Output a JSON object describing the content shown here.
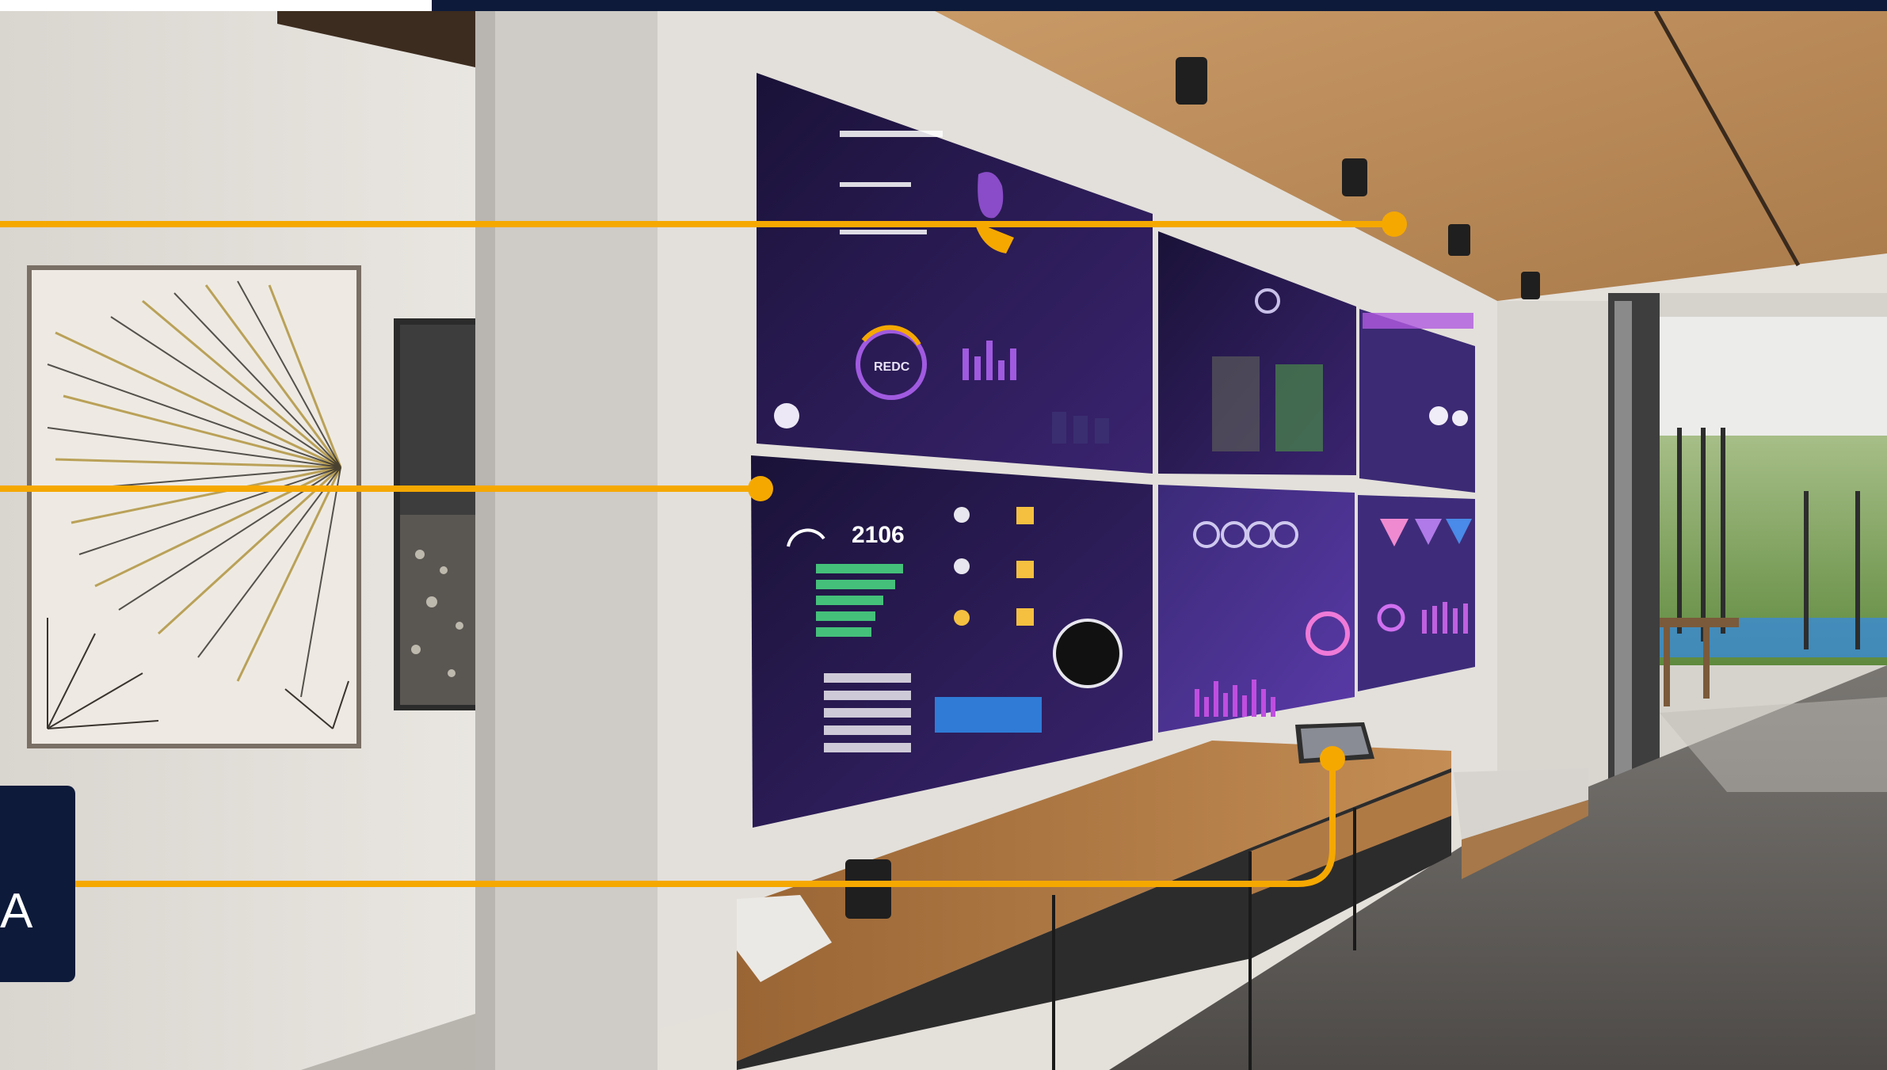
{
  "callout": {
    "letter": "A"
  },
  "dashboard": {
    "readout": "2106",
    "label_short": "REDC"
  },
  "colors": {
    "accent_line": "#f5a800",
    "brand_navy": "#0d1a3a",
    "screen_purple": "#2b1a57",
    "screen_violet": "#6a3fc4",
    "wood": "#b07a45"
  }
}
